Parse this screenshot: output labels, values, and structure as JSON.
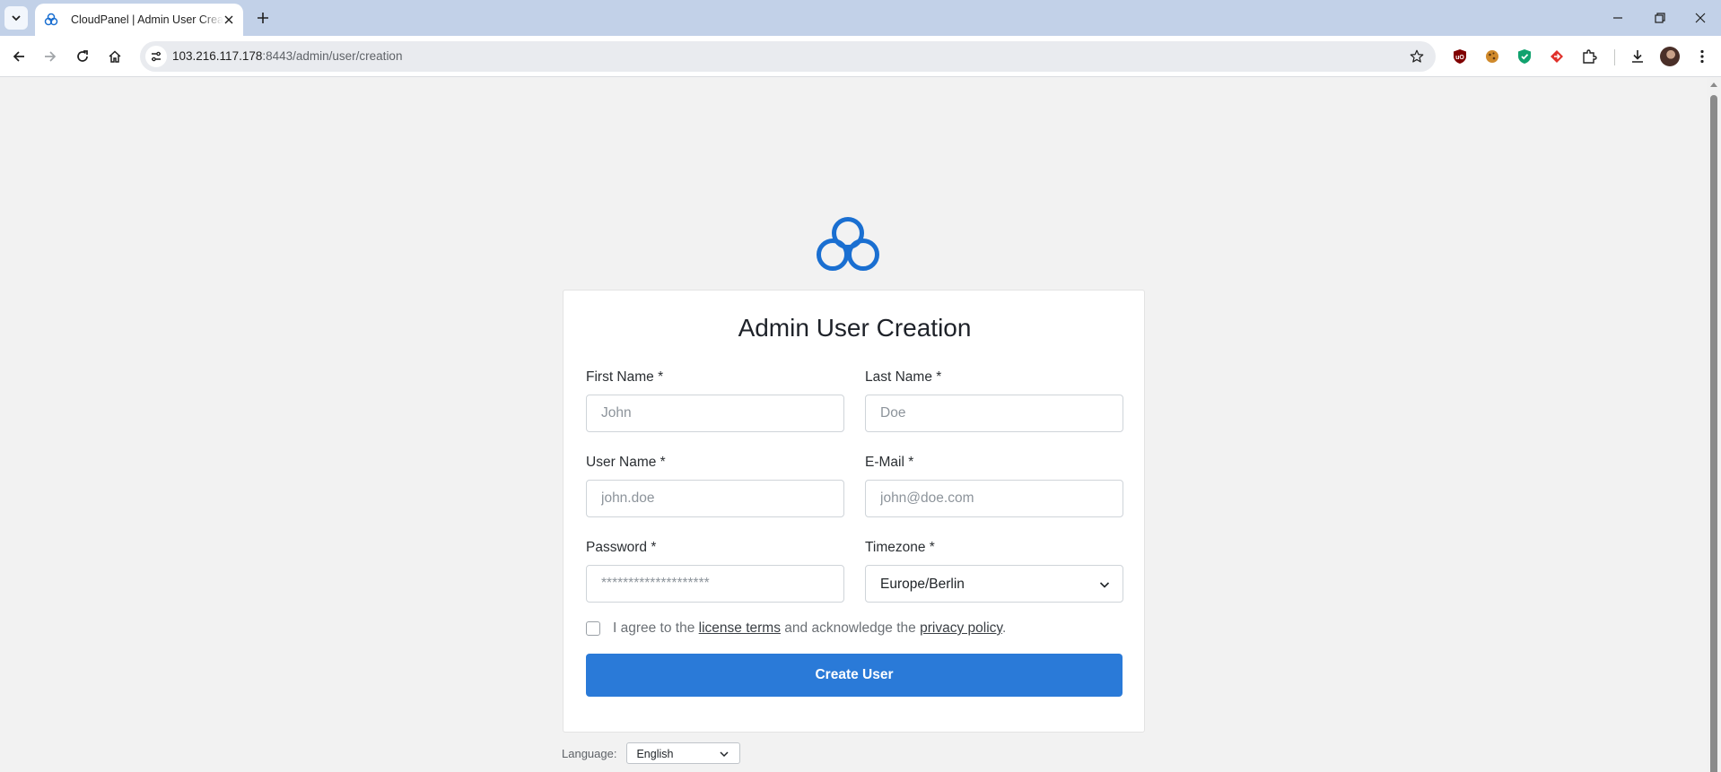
{
  "browser": {
    "tab_title": "CloudPanel | Admin User Creation",
    "url_host": "103.216.117.178",
    "url_path": ":8443/admin/user/creation"
  },
  "form": {
    "title": "Admin User Creation",
    "first_name": {
      "label": "First Name *",
      "placeholder": "John"
    },
    "last_name": {
      "label": "Last Name *",
      "placeholder": "Doe"
    },
    "user_name": {
      "label": "User Name *",
      "placeholder": "john.doe"
    },
    "email": {
      "label": "E-Mail *",
      "placeholder": "john@doe.com"
    },
    "password": {
      "label": "Password *",
      "placeholder": "********************"
    },
    "timezone": {
      "label": "Timezone *",
      "value": "Europe/Berlin"
    },
    "agree": {
      "prefix": "I agree to the",
      "license_link": "license terms",
      "middle": "and acknowledge the",
      "privacy_link": "privacy policy",
      "suffix": ".",
      "checked": false
    },
    "submit_label": "Create User"
  },
  "language": {
    "label": "Language:",
    "value": "English"
  },
  "colors": {
    "brand_blue": "#2a7ad8",
    "logo_blue": "#1a6fd1",
    "background": "#f2f2f2"
  },
  "icons": [
    "tab-list-icon",
    "cloudpanel-favicon",
    "close-icon",
    "plus-icon",
    "minimize-icon",
    "restore-icon",
    "back-icon",
    "forward-icon",
    "reload-icon",
    "home-icon",
    "site-info-icon",
    "star-icon",
    "ublock-icon",
    "cookie-icon",
    "shield-icon",
    "arrow-extension-icon",
    "puzzle-icon",
    "download-icon",
    "kebab-menu-icon",
    "cloudpanel-logo",
    "chevron-down-icon"
  ]
}
